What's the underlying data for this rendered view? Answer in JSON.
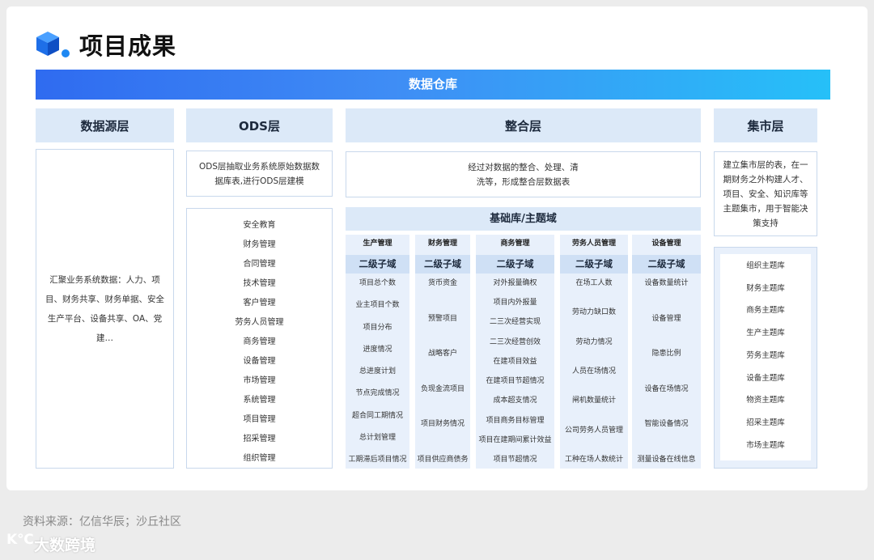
{
  "header": {
    "title": "项目成果",
    "banner": "数据仓库"
  },
  "layers": {
    "source": {
      "title": "数据源层",
      "desc": "汇聚业务系统数据：人力、项目、财务共享、财务单据、安全生产平台、设备共享、OA、党建…"
    },
    "ods": {
      "title": "ODS层",
      "desc": "ODS层抽取业务系统原始数据数据库表,进行ODS层建模",
      "items": [
        "安全教育",
        "财务管理",
        "合同管理",
        "技术管理",
        "客户管理",
        "劳务人员管理",
        "商务管理",
        "设备管理",
        "市场管理",
        "系统管理",
        "项目管理",
        "招采管理",
        "组织管理"
      ]
    },
    "integration": {
      "title": "整合层",
      "desc_line1": "经过对数据的整合、处理、清",
      "desc_line2": "洗等，形成整合层数据表",
      "base_title": "基础库/主题域",
      "sub_label": "二级子域",
      "columns": [
        {
          "name": "生产管理",
          "items": [
            "项目总个数",
            "业主项目个数",
            "项目分布",
            "进度情况",
            "总进度计划",
            "节点完成情况",
            "超合同工期情况",
            "总计划管理",
            "工期滞后项目情况"
          ]
        },
        {
          "name": "财务管理",
          "items": [
            "货币资金",
            "预警项目",
            "战略客户",
            "负现金流项目",
            "项目财务情况",
            "项目供应商债务"
          ]
        },
        {
          "name": "商务管理",
          "items": [
            "对外报量确权",
            "项目内外报量",
            "二三次经营实现",
            "二三次经营创效",
            "在建项目效益",
            "在建项目节超情况",
            "成本超支情况",
            "项目商务目标管理",
            "项目在建期间累计效益",
            "项目节超情况"
          ]
        },
        {
          "name": "劳务人员管理",
          "items": [
            "在场工人数",
            "劳动力缺口数",
            "劳动力情况",
            "人员在场情况",
            "闸机数量统计",
            "公司劳务人员管理",
            "工种在场人数统计"
          ]
        },
        {
          "name": "设备管理",
          "items": [
            "设备数量统计",
            "设备管理",
            "隐患比例",
            "设备在场情况",
            "智能设备情况",
            "测量设备在线信息"
          ]
        }
      ]
    },
    "mart": {
      "title": "集市层",
      "desc": "建立集市层的表，在一期财务之外构建人才、项目、安全、知识库等主题集市，用于智能决策支持",
      "items": [
        "组织主题库",
        "财务主题库",
        "商务主题库",
        "生产主题库",
        "劳务主题库",
        "设备主题库",
        "物资主题库",
        "招采主题库",
        "市场主题库"
      ]
    }
  },
  "footer": {
    "source": "资料来源：亿信华辰；沙丘社区",
    "watermark": "大数跨境"
  },
  "colors": {
    "banner_start": "#2f6bf0",
    "banner_end": "#26c0f8",
    "header_bg": "#dce9f8",
    "column_bg": "#e8f0fb"
  }
}
